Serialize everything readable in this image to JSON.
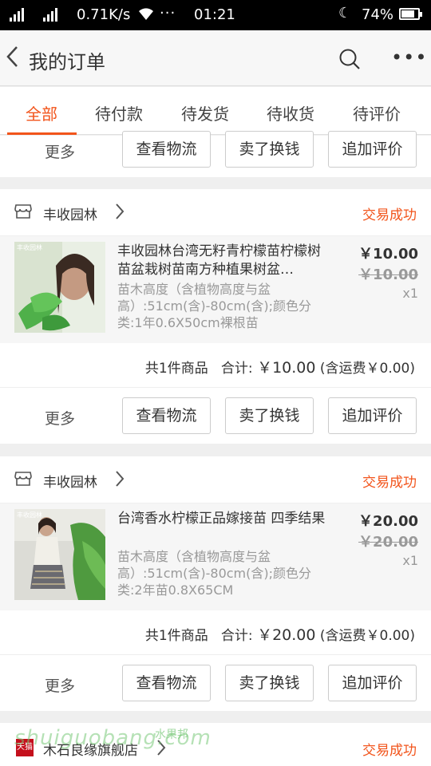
{
  "status_bar": {
    "network_speed": "0.71K/s",
    "dots": "···",
    "time": "01:21",
    "battery": "74%"
  },
  "nav": {
    "title": "我的订单",
    "more": "•••"
  },
  "tabs": [
    {
      "label": "全部",
      "active": true
    },
    {
      "label": "待付款",
      "active": false
    },
    {
      "label": "待发货",
      "active": false
    },
    {
      "label": "待收货",
      "active": false
    },
    {
      "label": "待评价",
      "active": false
    }
  ],
  "actions": {
    "more": "更多",
    "logistics": "查看物流",
    "resell": "卖了换钱",
    "review": "追加评价"
  },
  "orders": [
    {
      "shop": "丰收园林",
      "status": "交易成功",
      "item_title": "丰收园林台湾无籽青柠檬苗柠檬树苗盆栽树苗南方种植果树盆…",
      "item_spec": "苗木高度（含植物高度与盆高）:51cm(含)-80cm(含);颜色分类:1年0.6X50cm裸根苗",
      "price": "￥10.00",
      "orig_price": "￥10.00",
      "qty": "x1",
      "summary_count": "共1件商品",
      "summary_total_label": "合计:",
      "summary_total": "￥10.00",
      "summary_shipping": "(含运费￥0.00)",
      "thumb_label": "丰收园林"
    },
    {
      "shop": "丰收园林",
      "status": "交易成功",
      "item_title": "台湾香水柠檬正品嫁接苗 四季结果",
      "item_spec": "苗木高度（含植物高度与盆高）:51cm(含)-80cm(含);颜色分类:2年苗0.8X65CM",
      "price": "￥20.00",
      "orig_price": "￥20.00",
      "qty": "x1",
      "summary_count": "共1件商品",
      "summary_total_label": "合计:",
      "summary_total": "￥20.00",
      "summary_shipping": "(含运费￥0.00)",
      "thumb_label": "丰收园林"
    },
    {
      "shop": "木石良缘旗舰店",
      "status": "交易成功",
      "badge": "天猫"
    }
  ],
  "watermark": {
    "text": "shuiguobang.com",
    "text2": "水果邦"
  },
  "colors": {
    "accent": "#f2541b",
    "tmall": "#c4101c"
  }
}
